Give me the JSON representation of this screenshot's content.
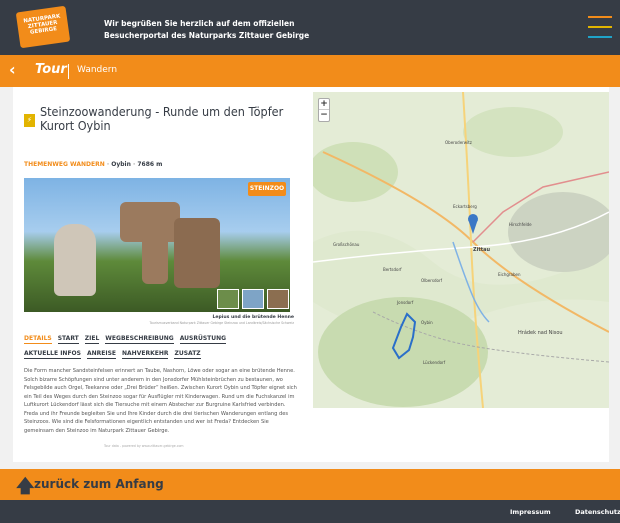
{
  "header": {
    "logo_text": "NATURPARK ZITTAUER GEBIRGE",
    "welcome_line1": "Wir begrüßen Sie herzlich auf dem offiziellen",
    "welcome_line2": "Besucherportal des Naturparks Zittauer Gebirge",
    "menu_colors": [
      "#f28c1a",
      "#e2b400",
      "#1fa3c9"
    ]
  },
  "nav": {
    "back_glyph": "‹",
    "title": "Tour",
    "subtitle": "Wandern"
  },
  "tour": {
    "icon_glyph": "⚡",
    "title": "Steinzoowanderung - Runde um den Töpfer Kurort Oybin",
    "category1": "THEMENWEG",
    "category2": "WANDERN",
    "location": "Oybin",
    "distance": "7686 m",
    "image_badge": "STEINZOO",
    "caption": "Lepius und die brütende Henne",
    "credit": "Tourismusverband Naturpark Zittauer Gebirge Steinzoo und Landkreis/Sächsische Schweiz",
    "tabs": [
      "DETAILS",
      "START",
      "ZIEL",
      "WEGBESCHREIBUNG",
      "AUSRÜSTUNG",
      "AKTUELLE INFOS",
      "ANREISE",
      "NAHVERKEHR",
      "ZUSATZ"
    ],
    "description": "Die Form mancher Sandsteinfelsen erinnert an Taube, Nashorn, Löwe oder sogar an eine brütende Henne. Solch bizarre Schöpfungen sind unter anderem in den Jonsdorfer Mühlsteinbrüchen zu bestaunen, wo Felsgebilde auch Orgel, Teekanne oder „Drei Brüder“ heißen. Zwischen Kurort Oybin und Töpfer eignet sich ein Teil des Weges durch den Steinzoo sogar für Ausflügler mit Kinderwagen. Rund um die Fuchskanzel im Luftkurort Lückendorf lässt sich die Tiersuche mit einem Abstecher zur Burgruine Karlsfried verbinden. Freda und ihr Freunde begleiten Sie und Ihre Kinder durch die drei tierischen Wanderungen entlang des Steinzoos. Wie sind die Felsformationen eigentlich entstanden und wer ist Freda? Entdecken Sie gemeinsam den Steinzoo im Naturpark Zittauer Gebirge.",
    "source": "Tour data - powered by www.zittauer-gebirge.com"
  },
  "map": {
    "zoom_in": "+",
    "zoom_out": "−",
    "places": [
      "Zittau",
      "Hrádek nad Nisou",
      "Oberoderwitz",
      "Eckartsberg",
      "Olbersdorf",
      "Jonsdorf",
      "Hirschfelde",
      "Großschönau",
      "Bertsdorf",
      "Oybin",
      "Lückendorf",
      "Eichgraben"
    ]
  },
  "bottom": {
    "arrow_glyph": "🡅",
    "label": "zurück zum Anfang"
  },
  "footer": {
    "impressum": "Impressum",
    "datenschutz": "Datenschutz"
  }
}
